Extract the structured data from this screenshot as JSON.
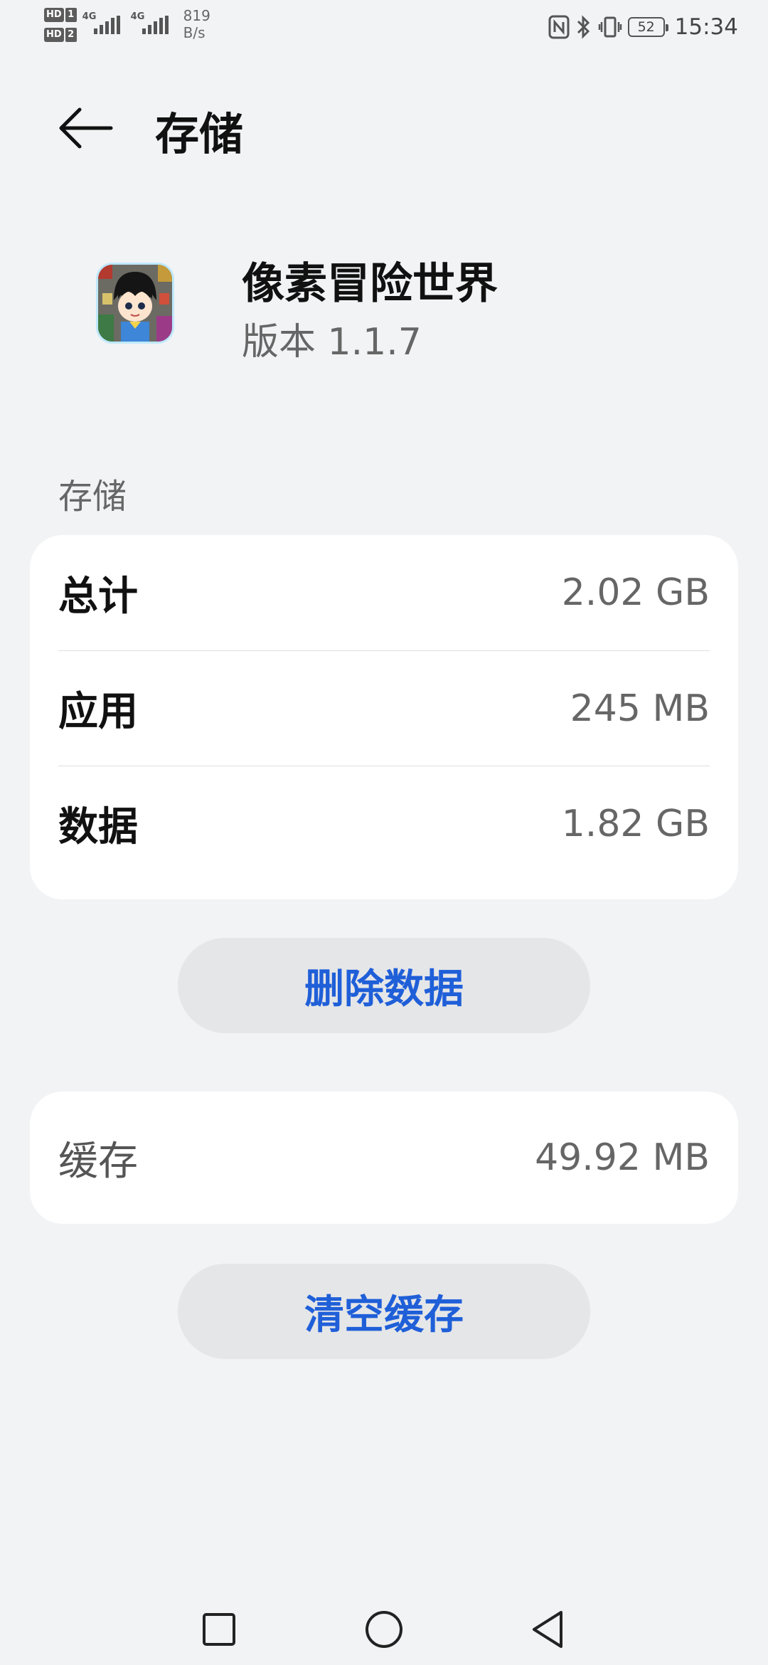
{
  "status_bar": {
    "sim1_label": "HD",
    "sim1_num": "1",
    "sim2_label": "HD",
    "sim2_num": "2",
    "sim1_network": "4G",
    "sim2_network": "4G",
    "net_speed_value": "819",
    "net_speed_unit": "B/s",
    "battery_level": "52",
    "time": "15:34",
    "icons": [
      "nfc-icon",
      "bluetooth-icon",
      "vibrate-icon",
      "battery-icon"
    ]
  },
  "header": {
    "title": "存储",
    "back_icon": "arrow-left-icon"
  },
  "app": {
    "name": "像素冒险世界",
    "version": "版本 1.1.7"
  },
  "storage": {
    "section_label": "存储",
    "rows": [
      {
        "label": "总计",
        "value": "2.02 GB"
      },
      {
        "label": "应用",
        "value": "245 MB"
      },
      {
        "label": "数据",
        "value": "1.82 GB"
      }
    ],
    "delete_button": "删除数据"
  },
  "cache": {
    "label": "缓存",
    "value": "49.92 MB",
    "clear_button": "清空缓存"
  },
  "nav": {
    "icons": [
      "recent-apps-icon",
      "home-icon",
      "back-icon"
    ]
  },
  "colors": {
    "background": "#f1f3f5",
    "card": "#ffffff",
    "accent": "#1f5fd8",
    "button_bg": "#e5e6e8"
  }
}
